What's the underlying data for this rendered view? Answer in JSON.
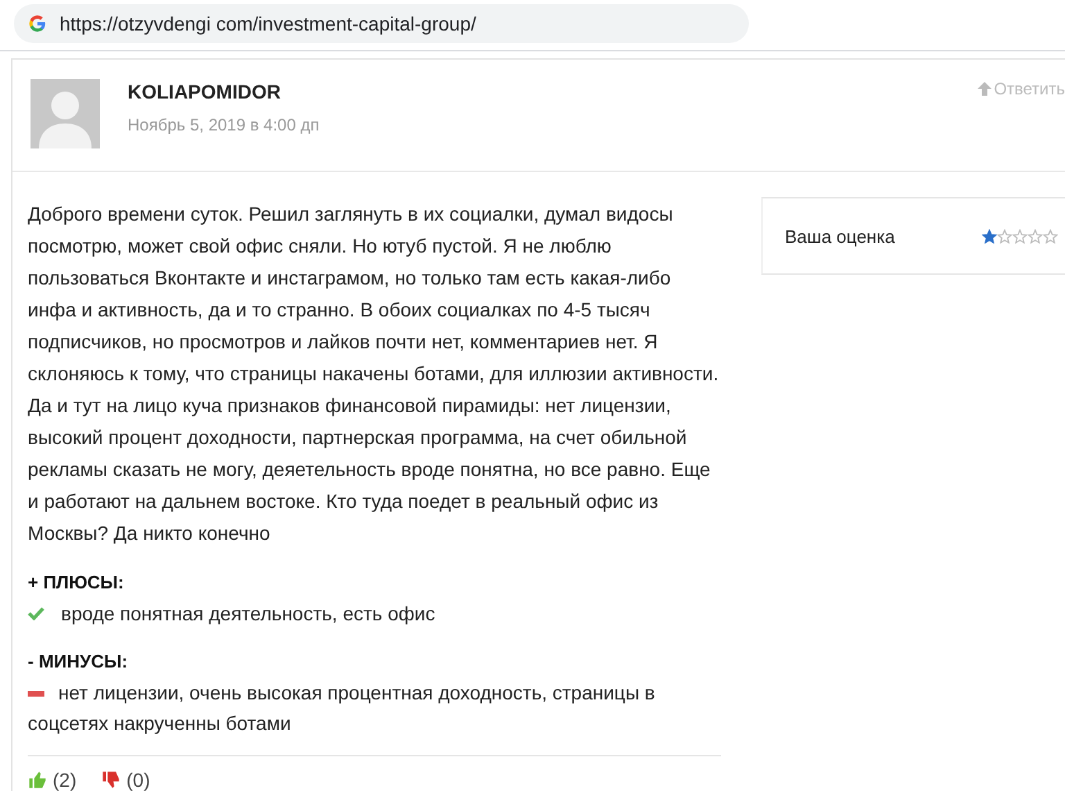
{
  "address_bar": {
    "url": "https://otzyvdengi com/investment-capital-group/"
  },
  "comment": {
    "author": "KOLIAPOMIDOR",
    "date": "Ноябрь 5, 2019 в 4:00 дп",
    "reply": "Ответить",
    "body": "Доброго времени суток. Решил заглянуть в их социалки, думал видосы посмотрю, может свой офис сняли. Но ютуб пустой. Я не люблю пользоваться Вконтакте и инстаграмом, но только там есть какая-либо инфа и активность, да и то странно. В обоих социалках по 4-5 тысяч подписчиков, но просмотров и лайков почти нет, комментариев нет. Я склоняюсь к тому, что страницы накачены ботами, для иллюзии активности. Да и тут на лицо куча признаков финансовой пирамиды: нет лицензии, высокий процент доходности, партнерская программа, на счет обильной рекламы сказать не могу, деяетельность вроде понятна, но все равно. Еще и работают на дальнем востоке. Кто туда поедет в реальный офис из Москвы? Да никто конечно",
    "sections": [
      {
        "kind": "pros",
        "heading": "+ ПЛЮСЫ:",
        "text": "вроде понятная деятельность, есть офис"
      },
      {
        "kind": "cons",
        "heading": "- МИНУСЫ:",
        "text": "нет лицензии, очень высокая процентная доходность, страницы в соцсетях накрученны ботами"
      }
    ],
    "votes": [
      {
        "kind": "up",
        "count": "(2)"
      },
      {
        "kind": "down",
        "count": "(0)"
      }
    ],
    "rating": {
      "label": "Ваша оценка",
      "stars": 1
    }
  }
}
